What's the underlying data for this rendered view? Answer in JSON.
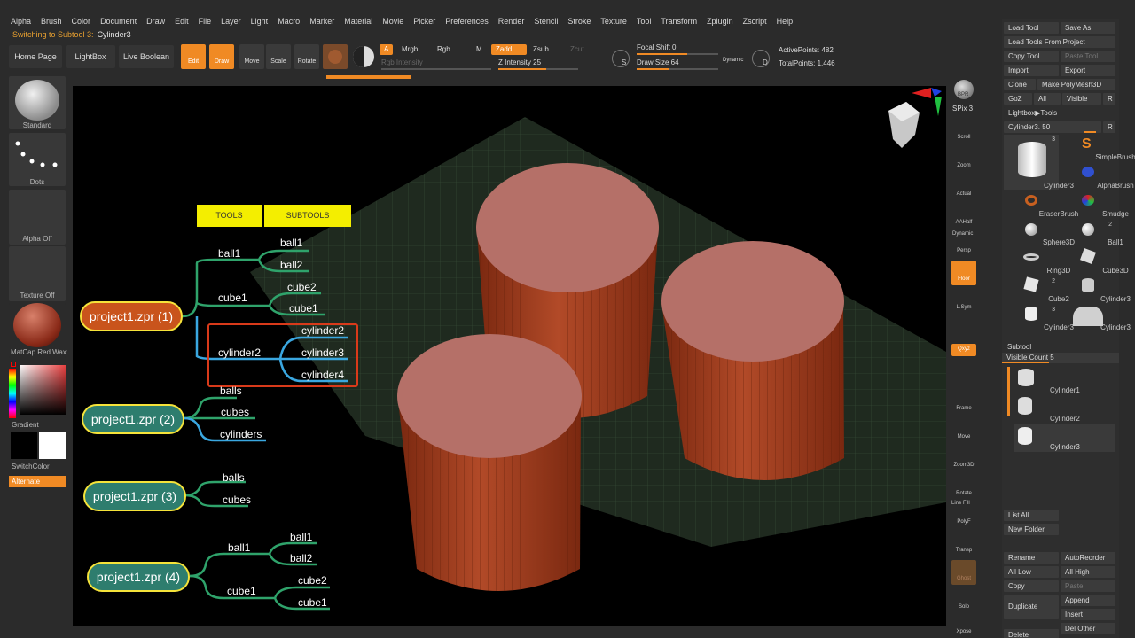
{
  "menu": [
    "Alpha",
    "Brush",
    "Color",
    "Document",
    "Draw",
    "Edit",
    "File",
    "Layer",
    "Light",
    "Macro",
    "Marker",
    "Material",
    "Movie",
    "Picker",
    "Preferences",
    "Render",
    "Stencil",
    "Stroke",
    "Texture",
    "Tool",
    "Transform",
    "Zplugin",
    "Zscript",
    "Help"
  ],
  "status": {
    "prefix": "Switching to Subtool 3:",
    "subtool": "Cylinder3"
  },
  "shelf": {
    "home": "Home Page",
    "lightbox": "LightBox",
    "live_boolean": "Live Boolean",
    "edit": "Edit",
    "draw": "Draw",
    "move": "Move",
    "scale": "Scale",
    "rotate": "Rotate",
    "a": "A",
    "mrgb": "Mrgb",
    "rgb": "Rgb",
    "m": "M",
    "zadd": "Zadd",
    "zsub": "Zsub",
    "zcut": "Zcut",
    "rgb_intensity": "Rgb Intensity",
    "z_intensity": "Z Intensity 25",
    "focal_shift": "Focal Shift 0",
    "draw_size": "Draw Size 64",
    "dynamic": "Dynamic",
    "active_points": "ActivePoints: 482",
    "total_points": "TotalPoints: 1,446",
    "d_letter": "D",
    "s_letter": "S"
  },
  "left_tray": {
    "brush": "Standard",
    "stroke": "Dots",
    "alpha": "Alpha Off",
    "texture": "Texture Off",
    "material": "MatCap Red Wax",
    "gradient": "Gradient",
    "switch_color": "SwitchColor",
    "alternate": "Alternate"
  },
  "right_toolbar": {
    "bpr": "BPR",
    "spix": "SPix 3",
    "scroll": "Scroll",
    "zoom": "Zoom",
    "actual": "Actual",
    "aahalf": "AAHalf",
    "persp": "Persp",
    "floor": "Floor",
    "lsym": "L.Sym",
    "xyz": "Qxyz",
    "frame": "Frame",
    "move": "Move",
    "zoom3d": "Zoom3D",
    "rotate": "Rotate",
    "linefill": "Line Fill",
    "polyf": "PolyF",
    "transp": "Transp",
    "ghost": "Ghost",
    "solo": "Solo",
    "xpose": "Xpose",
    "dynamic": "Dynamic"
  },
  "palette": {
    "load_tool": "Load Tool",
    "save_as": "Save As",
    "load_from_project": "Load Tools From Project",
    "copy_tool": "Copy Tool",
    "paste_tool": "Paste Tool",
    "import": "Import",
    "export": "Export",
    "clone": "Clone",
    "make_polymesh": "Make PolyMesh3D",
    "goz": "GoZ",
    "all": "All",
    "visible": "Visible",
    "r": "R",
    "lightbox_tools": "Lightbox▶Tools",
    "current_tool": "Cylinder3. 50",
    "tools": [
      {
        "label": "Cylinder3",
        "num": "3"
      },
      {
        "label": "SimpleBrush",
        "num": ""
      },
      {
        "label": "",
        "num": ""
      },
      {
        "label": "AlphaBrush",
        "num": ""
      },
      {
        "label": "EraserBrush",
        "num": ""
      },
      {
        "label": "Smudge",
        "num": ""
      },
      {
        "label": "Sphere3D",
        "num": ""
      },
      {
        "label": "Ball1",
        "num": "2"
      },
      {
        "label": "Ring3D",
        "num": ""
      },
      {
        "label": "Cube3D",
        "num": ""
      },
      {
        "label": "Cube2",
        "num": "2"
      },
      {
        "label": "Cylinder3",
        "num": ""
      },
      {
        "label": "Cylinder3",
        "num": "3"
      },
      {
        "label": "Cylinder3",
        "num": ""
      }
    ],
    "subtool_header": "Subtool",
    "visible_count": "Visible Count 5",
    "subtools": [
      "Cylinder1",
      "Cylinder2",
      "Cylinder3"
    ],
    "list_all": "List All",
    "new_folder": "New Folder",
    "rename": "Rename",
    "auto_reorder": "AutoReorder",
    "all_low": "All Low",
    "all_high": "All High",
    "copy": "Copy",
    "paste": "Paste",
    "duplicate": "Duplicate",
    "append": "Append",
    "insert": "Insert",
    "delete": "Delete",
    "del_other": "Del Other"
  },
  "mindmap": {
    "tag_tools": "TOOLS",
    "tag_subtools": "SUBTOOLS",
    "p1": "project1.zpr (1)",
    "p2": "project1.zpr (2)",
    "p3": "project1.zpr (3)",
    "p4": "project1.zpr (4)",
    "p1_ball1": "ball1",
    "p1_ball1_a": "ball1",
    "p1_ball1_b": "ball2",
    "p1_cube1": "cube1",
    "p1_cube1_a": "cube2",
    "p1_cube1_b": "cube1",
    "p1_cyl2": "cylinder2",
    "p1_cyl2_a": "cylinder2",
    "p1_cyl2_b": "cylinder3",
    "p1_cyl2_c": "cylinder4",
    "p2_a": "balls",
    "p2_b": "cubes",
    "p2_c": "cylinders",
    "p3_a": "balls",
    "p3_b": "cubes",
    "p4_ball1": "ball1",
    "p4_ball1_a": "ball1",
    "p4_ball1_b": "ball2",
    "p4_cube1": "cube1",
    "p4_cube1_a": "cube2",
    "p4_cube1_b": "cube1"
  },
  "colors": {
    "accent": "#f08a24",
    "node_p1": "#c9541c",
    "node_p2": "#2e7d6e",
    "edge_p1": "#f5e33a",
    "branch_green": "#2fa36b",
    "branch_blue": "#3aa7e0",
    "highlight": "#d93a1a"
  }
}
